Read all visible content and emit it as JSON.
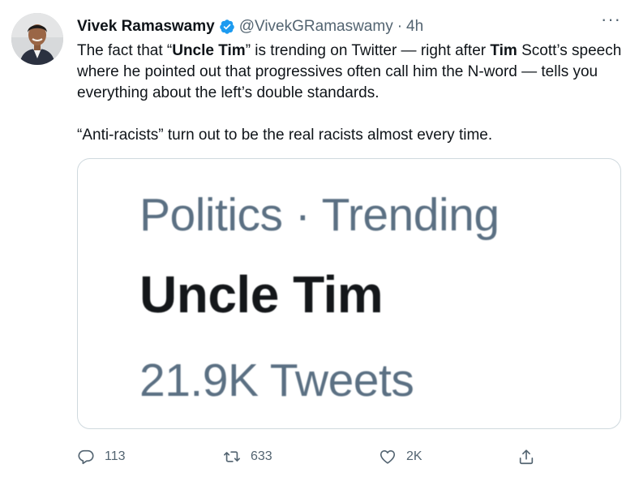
{
  "tweet": {
    "author_name": "Vivek Ramaswamy",
    "handle": "@VivekGRamaswamy",
    "separator": "·",
    "time": "4h",
    "more_label": "···",
    "text_parts": {
      "p1_a": "The fact that “",
      "p1_b": "Uncle Tim",
      "p1_c": "” is trending on Twitter — right after ",
      "p1_d": "Tim",
      "p1_e": " Scott’s speech where he pointed out that progressives often call him the N-word — tells you everything about the left’s double standards.",
      "p2": "“Anti-racists” turn out to be the real racists almost every time."
    }
  },
  "trend_card": {
    "category": "Politics · Trending",
    "title": "Uncle Tim",
    "count": "21.9K Tweets"
  },
  "actions": {
    "replies": "113",
    "retweets": "633",
    "likes": "2K"
  },
  "colors": {
    "verified": "#1d9bf0",
    "secondary_text": "#536471",
    "card_border": "#cfd9de"
  },
  "icons": [
    "verified-badge-icon",
    "more-icon",
    "reply-icon",
    "retweet-icon",
    "like-icon",
    "share-icon"
  ]
}
